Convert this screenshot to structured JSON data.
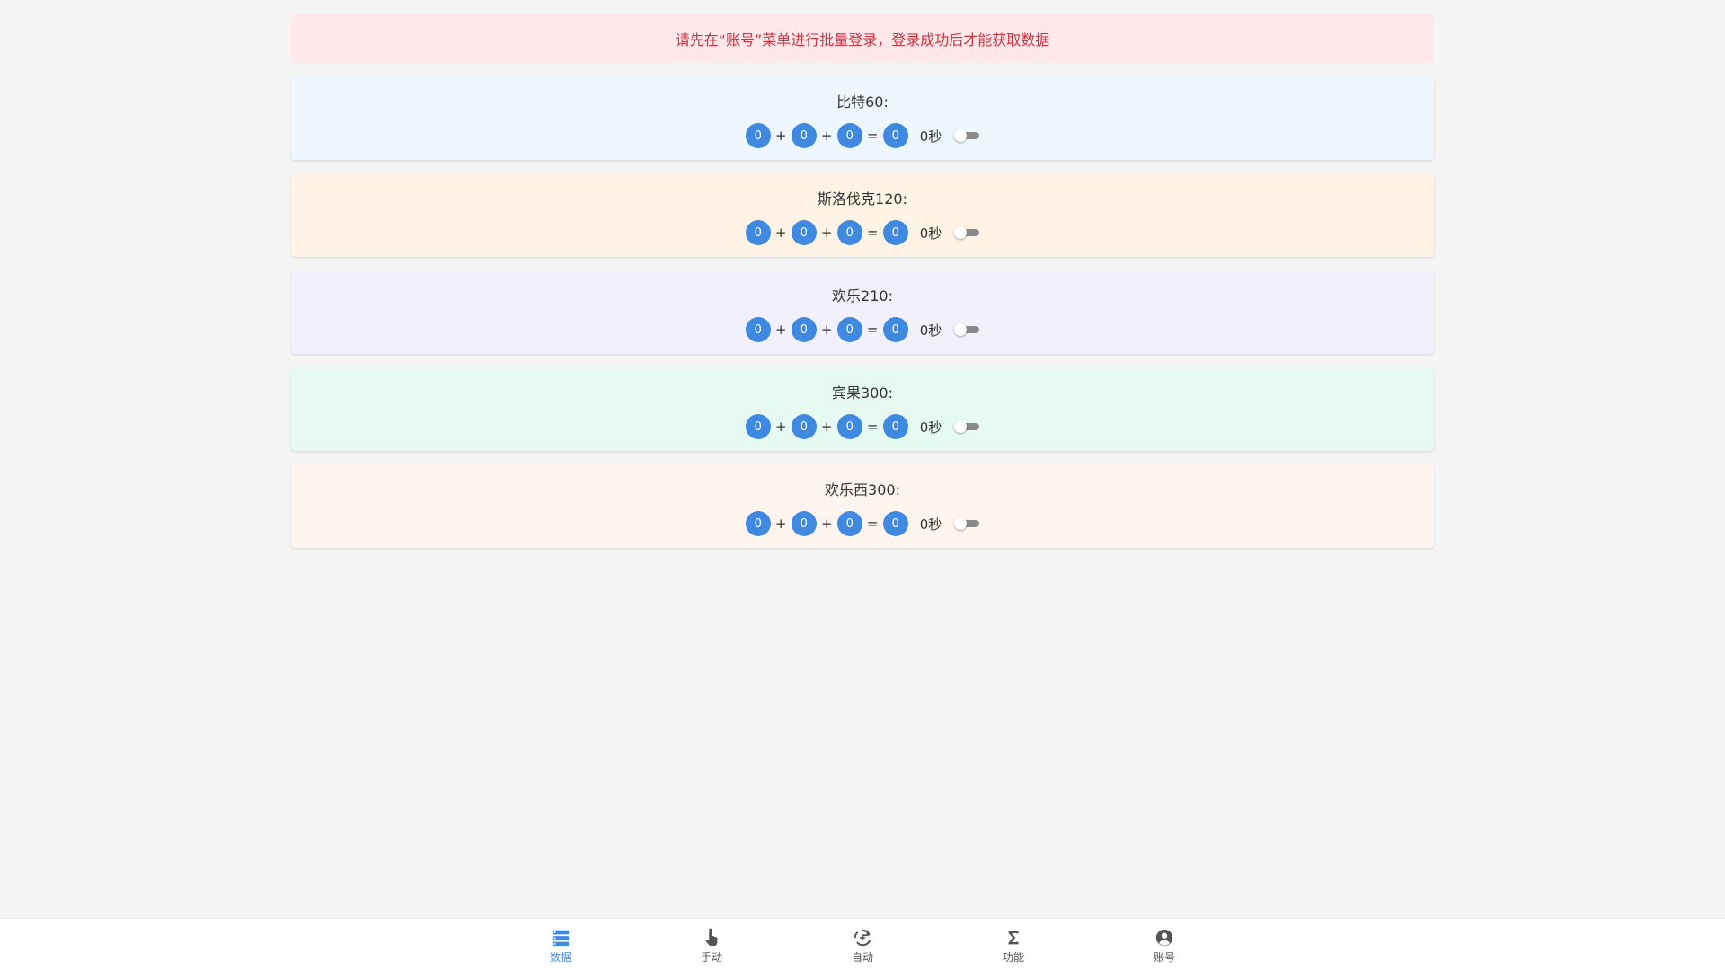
{
  "alert": {
    "text": "请先在“账号”菜单进行批量登录，登录成功后才能获取数据"
  },
  "cards": [
    {
      "title": "比特60:",
      "bg": "#eef6ff",
      "values": [
        "0",
        "0",
        "0",
        "0"
      ],
      "seconds": "0秒",
      "toggle_on": false
    },
    {
      "title": "斯洛伐克120:",
      "bg": "#fff3e5",
      "values": [
        "0",
        "0",
        "0",
        "0"
      ],
      "seconds": "0秒",
      "toggle_on": false
    },
    {
      "title": "欢乐210:",
      "bg": "#f2f0fd",
      "values": [
        "0",
        "0",
        "0",
        "0"
      ],
      "seconds": "0秒",
      "toggle_on": false
    },
    {
      "title": "宾果300:",
      "bg": "#e6faf1",
      "values": [
        "0",
        "0",
        "0",
        "0"
      ],
      "seconds": "0秒",
      "toggle_on": false
    },
    {
      "title": "欢乐西300:",
      "bg": "#fff5ee",
      "values": [
        "0",
        "0",
        "0",
        "0"
      ],
      "seconds": "0秒",
      "toggle_on": false
    }
  ],
  "operators": {
    "plus": "+",
    "equals": "="
  },
  "nav": [
    {
      "label": "数据",
      "icon": "storage-icon",
      "active": true
    },
    {
      "label": "手动",
      "icon": "tap-hand-icon",
      "active": false
    },
    {
      "label": "自动",
      "icon": "auto-refresh-icon",
      "active": false
    },
    {
      "label": "功能",
      "icon": "sigma-icon",
      "active": false
    },
    {
      "label": "账号",
      "icon": "account-icon",
      "active": false
    }
  ],
  "colors": {
    "accent": "#3f8ae0",
    "alert_text": "#d0343d",
    "alert_bg": "#ffe8ea"
  }
}
